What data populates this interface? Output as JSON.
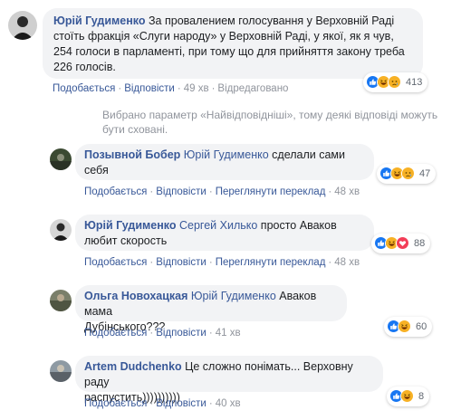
{
  "main_comment": {
    "author": "Юрій Гудименко",
    "text_lines": [
      "За провалением голосування у Верховній Раді",
      "стоїть фракція «Слуги народу» у Верховній Раді, у якої, як я чув,",
      "254 голоси в парламенті, при тому що для прийняття закону треба",
      "226 голосів."
    ],
    "actions": {
      "like": "Подобається",
      "reply": "Відповісти",
      "time": "49 хв",
      "edited": "Відредаговано"
    },
    "reactions": {
      "icons": [
        "like-icon",
        "haha-icon",
        "sad-icon"
      ],
      "count": "413"
    }
  },
  "notice": "Вибрано параметр «Найвідповідніші», тому деякі відповіді можуть бути сховані.",
  "replies": [
    {
      "author": "Позывной Бобер",
      "mention": "Юрій Гудименко",
      "text_first": "сделали сами",
      "text_second": "себя",
      "actions": {
        "like": "Подобається",
        "reply": "Відповісти",
        "translate": "Переглянути переклад",
        "time": "48 хв"
      },
      "reactions": {
        "icons": [
          "like-icon",
          "haha-icon",
          "sad-icon"
        ],
        "count": "47"
      }
    },
    {
      "author": "Юрій Гудименко",
      "mention": "Сергей Хилько",
      "text_first": "просто Аваков",
      "text_second": "любит скорость",
      "actions": {
        "like": "Подобається",
        "reply": "Відповісти",
        "translate": "Переглянути переклад",
        "time": "48 хв"
      },
      "reactions": {
        "icons": [
          "like-icon",
          "haha-icon",
          "love-icon"
        ],
        "count": "88"
      }
    },
    {
      "author": "Ольга Новохацкая",
      "mention": "Юрій Гудименко",
      "text_first": "Аваков мама",
      "text_second": "Дубінського???",
      "actions": {
        "like": "Подобається",
        "reply": "Відповісти",
        "time": "41 хв"
      },
      "reactions": {
        "icons": [
          "like-icon",
          "haha-icon"
        ],
        "count": "60"
      }
    },
    {
      "author": "Artem Dudchenko",
      "mention": "",
      "text_first": "Це сложно понімать... Верховну раду",
      "text_second": "распустить))))))))))",
      "actions": {
        "like": "Подобається",
        "reply": "Відповісти",
        "time": "40 хв"
      },
      "reactions": {
        "icons": [
          "like-icon",
          "haha-icon"
        ],
        "count": "8"
      }
    }
  ],
  "colors": {
    "link": "#385898",
    "like": "#1877f2",
    "love": "#f33e58",
    "haha": "#f7b125",
    "muted": "#90949c"
  }
}
